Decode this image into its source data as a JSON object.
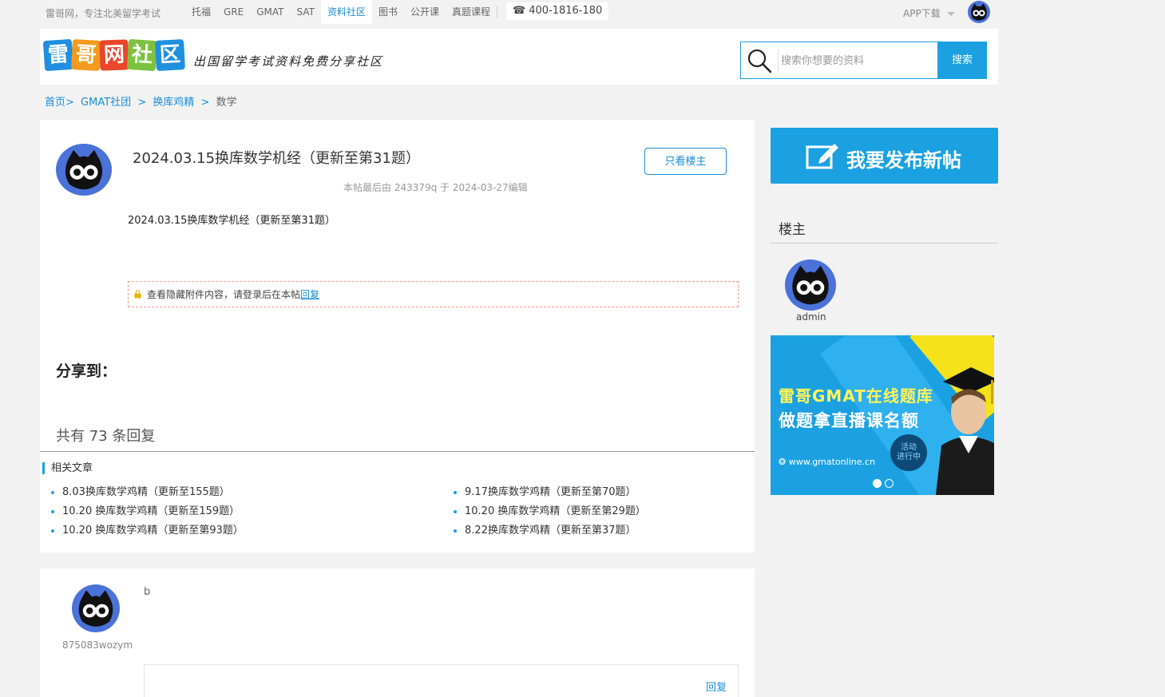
{
  "topbar": {
    "slogan": "雷哥网，专注北美留学考试",
    "nav": [
      "托福",
      "GRE",
      "GMAT",
      "SAT",
      "资料社区",
      "图书",
      "公开课",
      "真题课程"
    ],
    "active_nav": "资料社区",
    "phone_icon": "phone-icon",
    "phone": "400-1816-180",
    "app_download": "APP下载"
  },
  "header": {
    "logo_chars": [
      "雷",
      "哥",
      "网",
      "社",
      "区"
    ],
    "tagline": "出国留学考试资料免费分享社区",
    "search_placeholder": "搜索你想要的资料",
    "search_button": "搜索"
  },
  "breadcrumb": {
    "home": "首页>",
    "group": "GMAT社团",
    "sep1": ">",
    "section": "换库鸡精",
    "sep2": ">",
    "current": "数学"
  },
  "post": {
    "title": "2024.03.15换库数学机经（更新至第31题）",
    "only_host": "只看楼主",
    "edit_note": "本帖最后由 243379q 于 2024-03-27编辑",
    "body": "2024.03.15换库数学机经（更新至第31题）",
    "hidden_text": "查看隐藏附件内容，请登录后在本帖",
    "hidden_link": "回复",
    "share_label": "分享到：",
    "reply_count": "共有 73 条回复"
  },
  "related": {
    "title": "相关文章",
    "items": [
      "8.03换库数学鸡精（更新至155题）",
      "9.17换库数学鸡精（更新至第70题）",
      "10.20 换库数学鸡精（更新至159题）",
      "10.20 换库数学鸡精（更新至第29题）",
      "10.20 换库数学鸡精（更新至第93题）",
      "8.22换库数学鸡精（更新至第37题）"
    ]
  },
  "reply": {
    "username": "875083wozym",
    "content": "b",
    "reply_button": "回复"
  },
  "sidebar": {
    "new_post": "我要发布新帖",
    "host_title": "楼主",
    "host_name": "admin",
    "banner": {
      "line1": "雷哥GMAT在线题库",
      "line2": "做题拿直播课名额",
      "url": "www.gmatonline.cn",
      "badge": "活动\n进行中",
      "slide_count": 2,
      "active_slide": 1
    }
  },
  "colors": {
    "accent": "#1ba1e2",
    "link": "#1a8dd8",
    "avatar_bg": "#4a72d8",
    "banner_yellow": "#fff45a"
  }
}
